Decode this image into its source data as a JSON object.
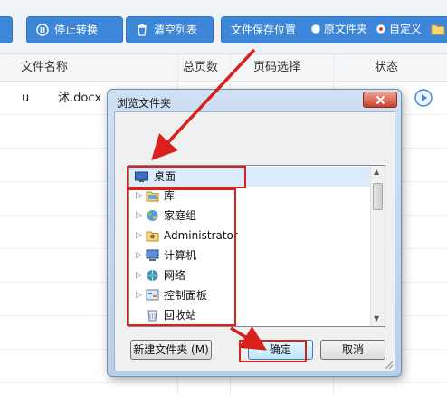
{
  "toolbar": {
    "stop_convert": "停止转换",
    "clear_list": "清空列表",
    "save_location": "文件保存位置",
    "option_original": "原文件夹",
    "option_custom": "自定义",
    "selected_option": "自定义"
  },
  "table": {
    "columns": [
      "文件名称",
      "总页数",
      "页码选择",
      "状态"
    ],
    "rows": [
      {
        "prefix": "u",
        "filename": "沭.docx"
      }
    ]
  },
  "dialog": {
    "title": "浏览文件夹",
    "tree": [
      {
        "label": "桌面",
        "icon": "desktop-icon"
      },
      {
        "label": "库",
        "icon": "library-icon"
      },
      {
        "label": "家庭组",
        "icon": "homegroup-icon"
      },
      {
        "label": "Administrator",
        "icon": "user-folder-icon"
      },
      {
        "label": "计算机",
        "icon": "computer-icon"
      },
      {
        "label": "网络",
        "icon": "network-icon"
      },
      {
        "label": "控制面板",
        "icon": "control-panel-icon"
      },
      {
        "label": "回收站",
        "icon": "recycle-bin-icon"
      }
    ],
    "new_folder": "新建文件夹 (M)",
    "ok": "确定",
    "cancel": "取消"
  },
  "colors": {
    "accent": "#3d86d8",
    "annotation": "#d9201d"
  }
}
